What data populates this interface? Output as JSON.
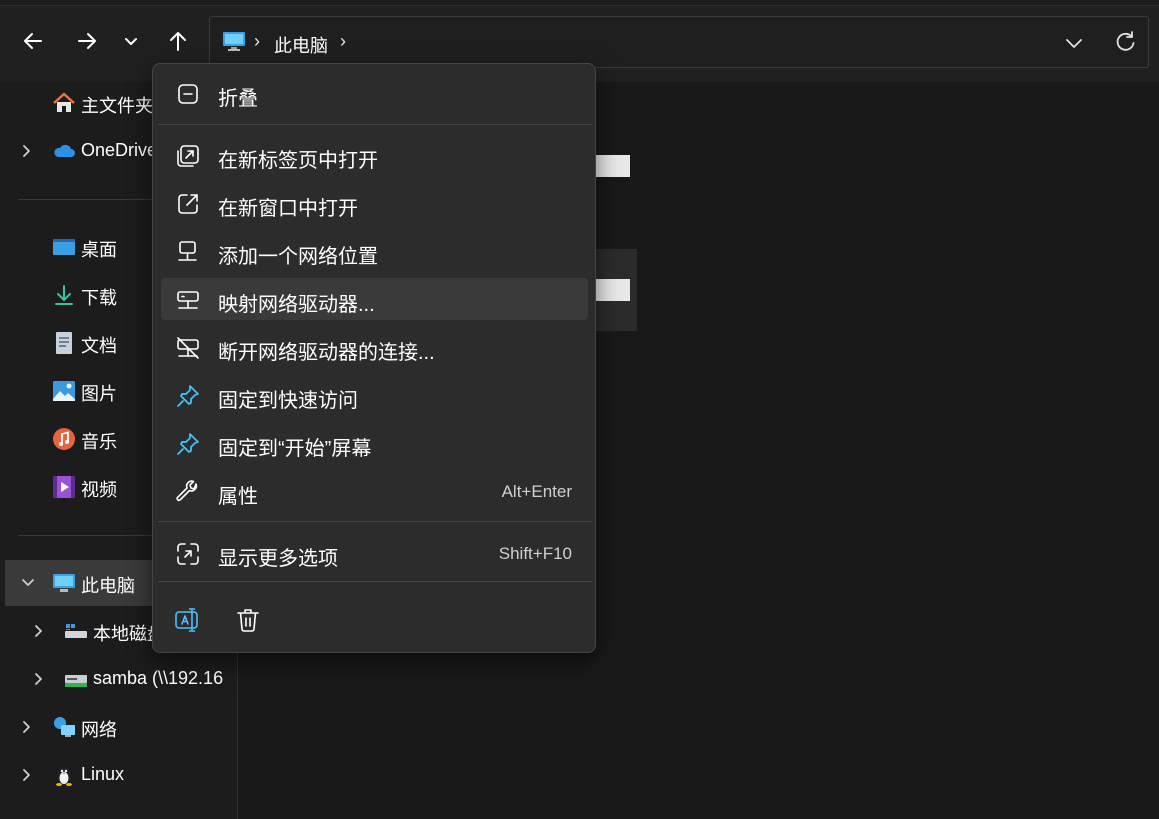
{
  "address": {
    "crumb": "此电脑",
    "separator": "›"
  },
  "sidebar": {
    "home": "主文件夹",
    "onedrive": "OneDrive",
    "items": [
      "桌面",
      "下载",
      "文档",
      "图片",
      "音乐",
      "视频"
    ],
    "this_pc": "此电脑",
    "local_disk": "本地磁盘",
    "samba": "samba (\\\\192.16",
    "network": "网络",
    "linux": "Linux"
  },
  "menu": {
    "collapse": "折叠",
    "open_new_tab": "在新标签页中打开",
    "open_new_window": "在新窗口中打开",
    "add_network_location": "添加一个网络位置",
    "map_network_drive": "映射网络驱动器...",
    "disconnect_network_drive": "断开网络驱动器的连接...",
    "pin_quick_access": "固定到快速访问",
    "pin_start": "固定到“开始”屏幕",
    "properties": "属性",
    "properties_shortcut": "Alt+Enter",
    "show_more": "显示更多选项",
    "show_more_shortcut": "Shift+F10"
  },
  "colors": {
    "accent": "#4cc2ff",
    "menu_bg": "#2c2c2c",
    "hover": "#3a3a3a"
  }
}
